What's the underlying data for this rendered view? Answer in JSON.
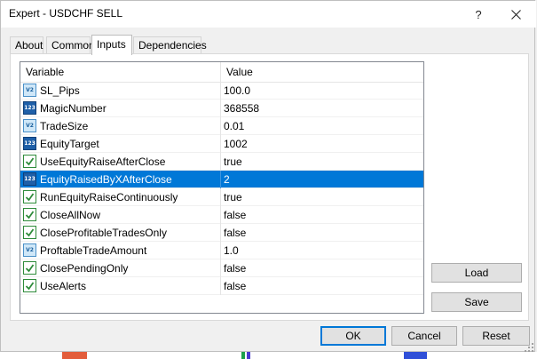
{
  "window": {
    "title": "Expert - USDCHF SELL",
    "help_label": "?"
  },
  "tabs": [
    {
      "label": "About",
      "active": false
    },
    {
      "label": "Common",
      "active": false
    },
    {
      "label": "Inputs",
      "active": true
    },
    {
      "label": "Dependencies",
      "active": false
    }
  ],
  "grid": {
    "headers": {
      "variable": "Variable",
      "value": "Value"
    },
    "rows": [
      {
        "icon": "string-icon",
        "icon_text": "V2",
        "name": "SL_Pips",
        "value": "100.0",
        "selected": false
      },
      {
        "icon": "integer-icon",
        "icon_text": "123",
        "name": "MagicNumber",
        "value": "368558",
        "selected": false
      },
      {
        "icon": "string-icon",
        "icon_text": "V2",
        "name": "TradeSize",
        "value": "0.01",
        "selected": false
      },
      {
        "icon": "integer-icon",
        "icon_text": "123",
        "name": "EquityTarget",
        "value": "1002",
        "selected": false
      },
      {
        "icon": "boolean-icon",
        "icon_text": "",
        "name": "UseEquityRaiseAfterClose",
        "value": "true",
        "selected": false
      },
      {
        "icon": "integer-icon",
        "icon_text": "123",
        "name": "EquityRaisedByXAfterClose",
        "value": "2",
        "selected": true
      },
      {
        "icon": "boolean-icon",
        "icon_text": "",
        "name": "RunEquityRaiseContinuously",
        "value": "true",
        "selected": false
      },
      {
        "icon": "boolean-icon",
        "icon_text": "",
        "name": "CloseAllNow",
        "value": "false",
        "selected": false
      },
      {
        "icon": "boolean-icon",
        "icon_text": "",
        "name": "CloseProfitableTradesOnly",
        "value": "false",
        "selected": false
      },
      {
        "icon": "string-icon",
        "icon_text": "V2",
        "name": "ProftableTradeAmount",
        "value": "1.0",
        "selected": false
      },
      {
        "icon": "boolean-icon",
        "icon_text": "",
        "name": "ClosePendingOnly",
        "value": "false",
        "selected": false
      },
      {
        "icon": "boolean-icon",
        "icon_text": "",
        "name": "UseAlerts",
        "value": "false",
        "selected": false
      }
    ]
  },
  "buttons": {
    "load": "Load",
    "save": "Save",
    "ok": "OK",
    "cancel": "Cancel",
    "reset": "Reset"
  },
  "colors": {
    "selection": "#0078d7",
    "default_button_border": "#0078d7"
  }
}
